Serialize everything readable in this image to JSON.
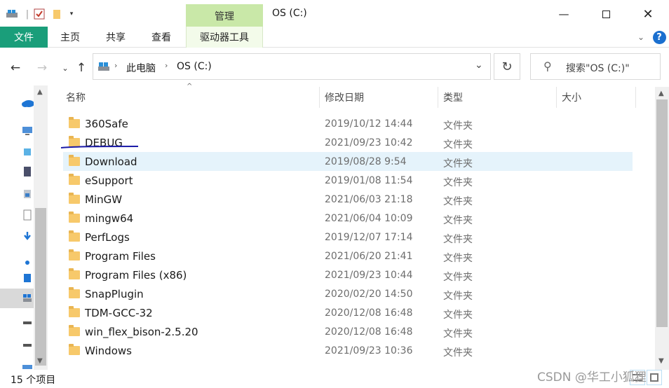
{
  "window": {
    "title": "OS (C:)",
    "minimize_icon": "minimize-icon",
    "maximize_icon": "maximize-icon",
    "close_icon": "close-icon"
  },
  "quick_access": [
    "drive-icon",
    "properties-checkbox-icon",
    "new-folder-icon",
    "customize-dropdown-icon"
  ],
  "ribbon": {
    "contextual_group": "管理",
    "tabs": [
      {
        "label": "文件"
      },
      {
        "label": "主页"
      },
      {
        "label": "共享"
      },
      {
        "label": "查看"
      },
      {
        "label": "驱动器工具"
      }
    ]
  },
  "address": {
    "crumbs": [
      "此电脑",
      "OS (C:)"
    ],
    "search_placeholder": "搜索\"OS (C:)\""
  },
  "columns": {
    "name": "名称",
    "date": "修改日期",
    "type": "类型",
    "size": "大小"
  },
  "files": [
    {
      "name": "360Safe",
      "date": "2019/10/12 14:44",
      "type": "文件夹"
    },
    {
      "name": "DEBUG",
      "date": "2021/09/23 10:42",
      "type": "文件夹"
    },
    {
      "name": "Download",
      "date": "2019/08/28 9:54",
      "type": "文件夹"
    },
    {
      "name": "eSupport",
      "date": "2019/01/08 11:54",
      "type": "文件夹"
    },
    {
      "name": "MinGW",
      "date": "2021/06/03 21:18",
      "type": "文件夹"
    },
    {
      "name": "mingw64",
      "date": "2021/06/04 10:09",
      "type": "文件夹"
    },
    {
      "name": "PerfLogs",
      "date": "2019/12/07 17:14",
      "type": "文件夹"
    },
    {
      "name": "Program Files",
      "date": "2021/06/20 21:41",
      "type": "文件夹"
    },
    {
      "name": "Program Files (x86)",
      "date": "2021/09/23 10:44",
      "type": "文件夹"
    },
    {
      "name": "SnapPlugin",
      "date": "2020/02/20 14:50",
      "type": "文件夹"
    },
    {
      "name": "TDM-GCC-32",
      "date": "2020/12/08 16:48",
      "type": "文件夹"
    },
    {
      "name": "win_flex_bison-2.5.20",
      "date": "2020/12/08 16:48",
      "type": "文件夹"
    },
    {
      "name": "Windows",
      "date": "2021/09/23 10:36",
      "type": "文件夹"
    }
  ],
  "selected_index": 2,
  "status": {
    "item_count": "15 个项目"
  },
  "watermark": "CSDN @华工小狐狸",
  "colors": {
    "file_tab": "#1a9e7a",
    "context_tab": "#c9e8a8",
    "selection": "#e5f3fb",
    "folder": "#f7c96b",
    "help": "#1a6fcf",
    "annotation_underline": "#1a1aa8"
  }
}
